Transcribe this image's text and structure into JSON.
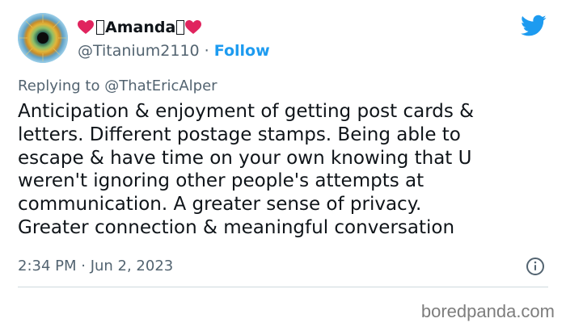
{
  "user": {
    "display_name": "Amanda",
    "handle": "@Titanium2110",
    "separator": " · ",
    "follow_label": "Follow"
  },
  "reply": {
    "prefix": "Replying to ",
    "handle": "@ThatEricAlper"
  },
  "tweet": {
    "text": "Anticipation & enjoyment of getting post cards &\nletters. Different postage stamps. Being able to\nescape & have time on your own knowing that U\nweren't ignoring other people's attempts at\ncommunication. A greater sense of privacy.\nGreater connection & meaningful conversation",
    "timestamp": "2:34 PM · Jun 2, 2023"
  },
  "watermark": "boredpanda.com",
  "colors": {
    "accent": "#1d9bf0",
    "heart": "#e0245e",
    "secondary_text": "#536471"
  },
  "icons": {
    "brand": "twitter-bird-icon",
    "info": "info-icon",
    "decoration": "red-heart-icon"
  }
}
